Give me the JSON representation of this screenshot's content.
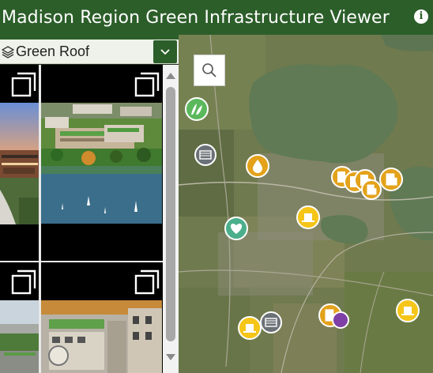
{
  "header": {
    "title": "Madison Region Green Infrastructure Viewer",
    "info_icon": "info-icon"
  },
  "layer_selector": {
    "selected": "Green Roof",
    "icon": "layers-icon",
    "dropdown_icon": "chevron-down-icon"
  },
  "colors": {
    "header_bg": "#2c5e2a",
    "pin_green": "#5bb85c",
    "pin_orange": "#e3a21a",
    "pin_yellow": "#f5c518",
    "pin_gray": "#6b7177",
    "pin_teal": "#4caf8c",
    "pin_purple": "#7e3fa6"
  },
  "gallery": {
    "cards": [
      {
        "name": "card-1",
        "expand_icon": "expand-icon"
      },
      {
        "name": "card-2",
        "expand_icon": "expand-icon"
      },
      {
        "name": "card-3",
        "expand_icon": "expand-icon"
      },
      {
        "name": "card-4",
        "expand_icon": "expand-icon"
      }
    ]
  },
  "map": {
    "search_icon": "search-icon"
  }
}
